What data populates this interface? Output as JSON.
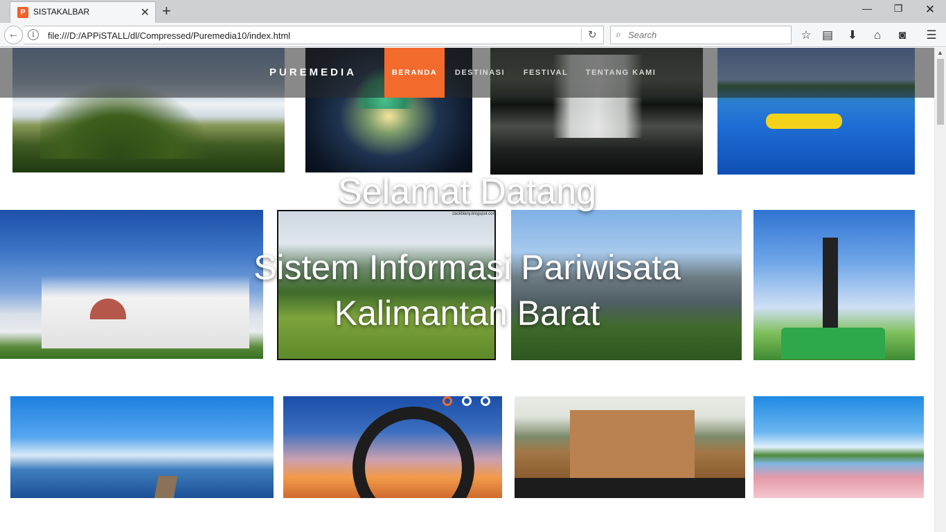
{
  "browser": {
    "tab_title": "SISTAKALBAR",
    "url": "file:///D:/APPiSTALL/dl/Compressed/Puremedia10/index.html",
    "search_placeholder": "Search"
  },
  "site": {
    "brand": "PUREMEDIA",
    "menu": [
      {
        "label": "BERANDA",
        "active": true
      },
      {
        "label": "DESTINASI",
        "active": false
      },
      {
        "label": "FESTIVAL",
        "active": false
      },
      {
        "label": "TENTANG KAMI",
        "active": false
      }
    ],
    "hero": {
      "greeting": "Selamat Datang",
      "title_line1": "Sistem Informasi Pariwisata",
      "title_line2": "Kalimantan Barat"
    },
    "slider_dots": [
      {
        "active": true
      },
      {
        "active": false
      },
      {
        "active": false
      }
    ],
    "photo_watermark": "zackblany.blogspot.com"
  },
  "colors": {
    "accent": "#f26a2c",
    "header_overlay": "rgba(40,40,40,0.55)"
  }
}
